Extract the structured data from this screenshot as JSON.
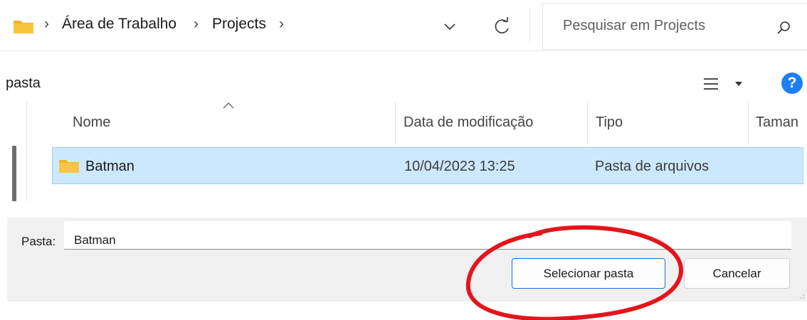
{
  "address_bar": {
    "breadcrumbs": [
      {
        "label": "Área de Trabalho"
      },
      {
        "label": "Projects"
      }
    ],
    "separator": "›",
    "search_placeholder": "Pesquisar em Projects"
  },
  "toolbar": {
    "label": "pasta",
    "help_label": "?"
  },
  "file_list": {
    "columns": [
      {
        "label": "Nome"
      },
      {
        "label": "Data de modificação"
      },
      {
        "label": "Tipo"
      },
      {
        "label": "Taman"
      }
    ],
    "rows": [
      {
        "name": "Batman",
        "modified": "10/04/2023 13:25",
        "type": "Pasta de arquivos",
        "selected": true
      }
    ]
  },
  "bottom_panel": {
    "folder_label": "Pasta:",
    "folder_value": "Batman",
    "select_button": "Selecionar pasta",
    "cancel_button": "Cancelar"
  },
  "colors": {
    "selection_bg": "#cce8ff",
    "selection_border": "#99d1ff",
    "help_blue": "#1d7ff2",
    "folder_yellow": "#f8c53f",
    "annotation_red": "#e2161c"
  },
  "icons": [
    "folder-icon",
    "chevron-right-icon",
    "chevron-down-icon",
    "refresh-icon",
    "search-icon",
    "view-list-icon",
    "caret-down-icon",
    "help-icon",
    "sort-ascending-icon",
    "resize-grip-icon"
  ]
}
